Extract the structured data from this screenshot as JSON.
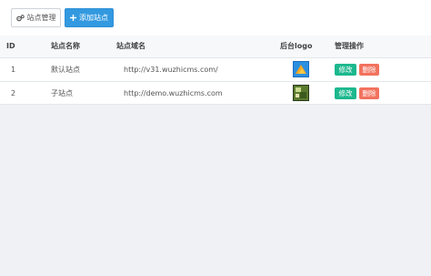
{
  "toolbar": {
    "manage_label": "站点管理",
    "add_label": "添加站点"
  },
  "table": {
    "headers": {
      "id": "ID",
      "name": "站点名称",
      "domain": "站点域名",
      "logo": "后台logo",
      "ops": "管理操作"
    },
    "rows": [
      {
        "id": "1",
        "name": "默认站点",
        "domain": "http://v31.wuzhicms.com/",
        "edit": "修改",
        "delete": "删除"
      },
      {
        "id": "2",
        "name": "子站点",
        "domain": "http://demo.wuzhicms.com",
        "edit": "修改",
        "delete": "删除"
      }
    ]
  },
  "colors": {
    "primary": "#3399e0",
    "edit": "#1cb88e",
    "delete": "#f2725e",
    "background": "#eff1f4"
  },
  "icons": {
    "manage": "gears-icon",
    "add": "plus-icon"
  }
}
